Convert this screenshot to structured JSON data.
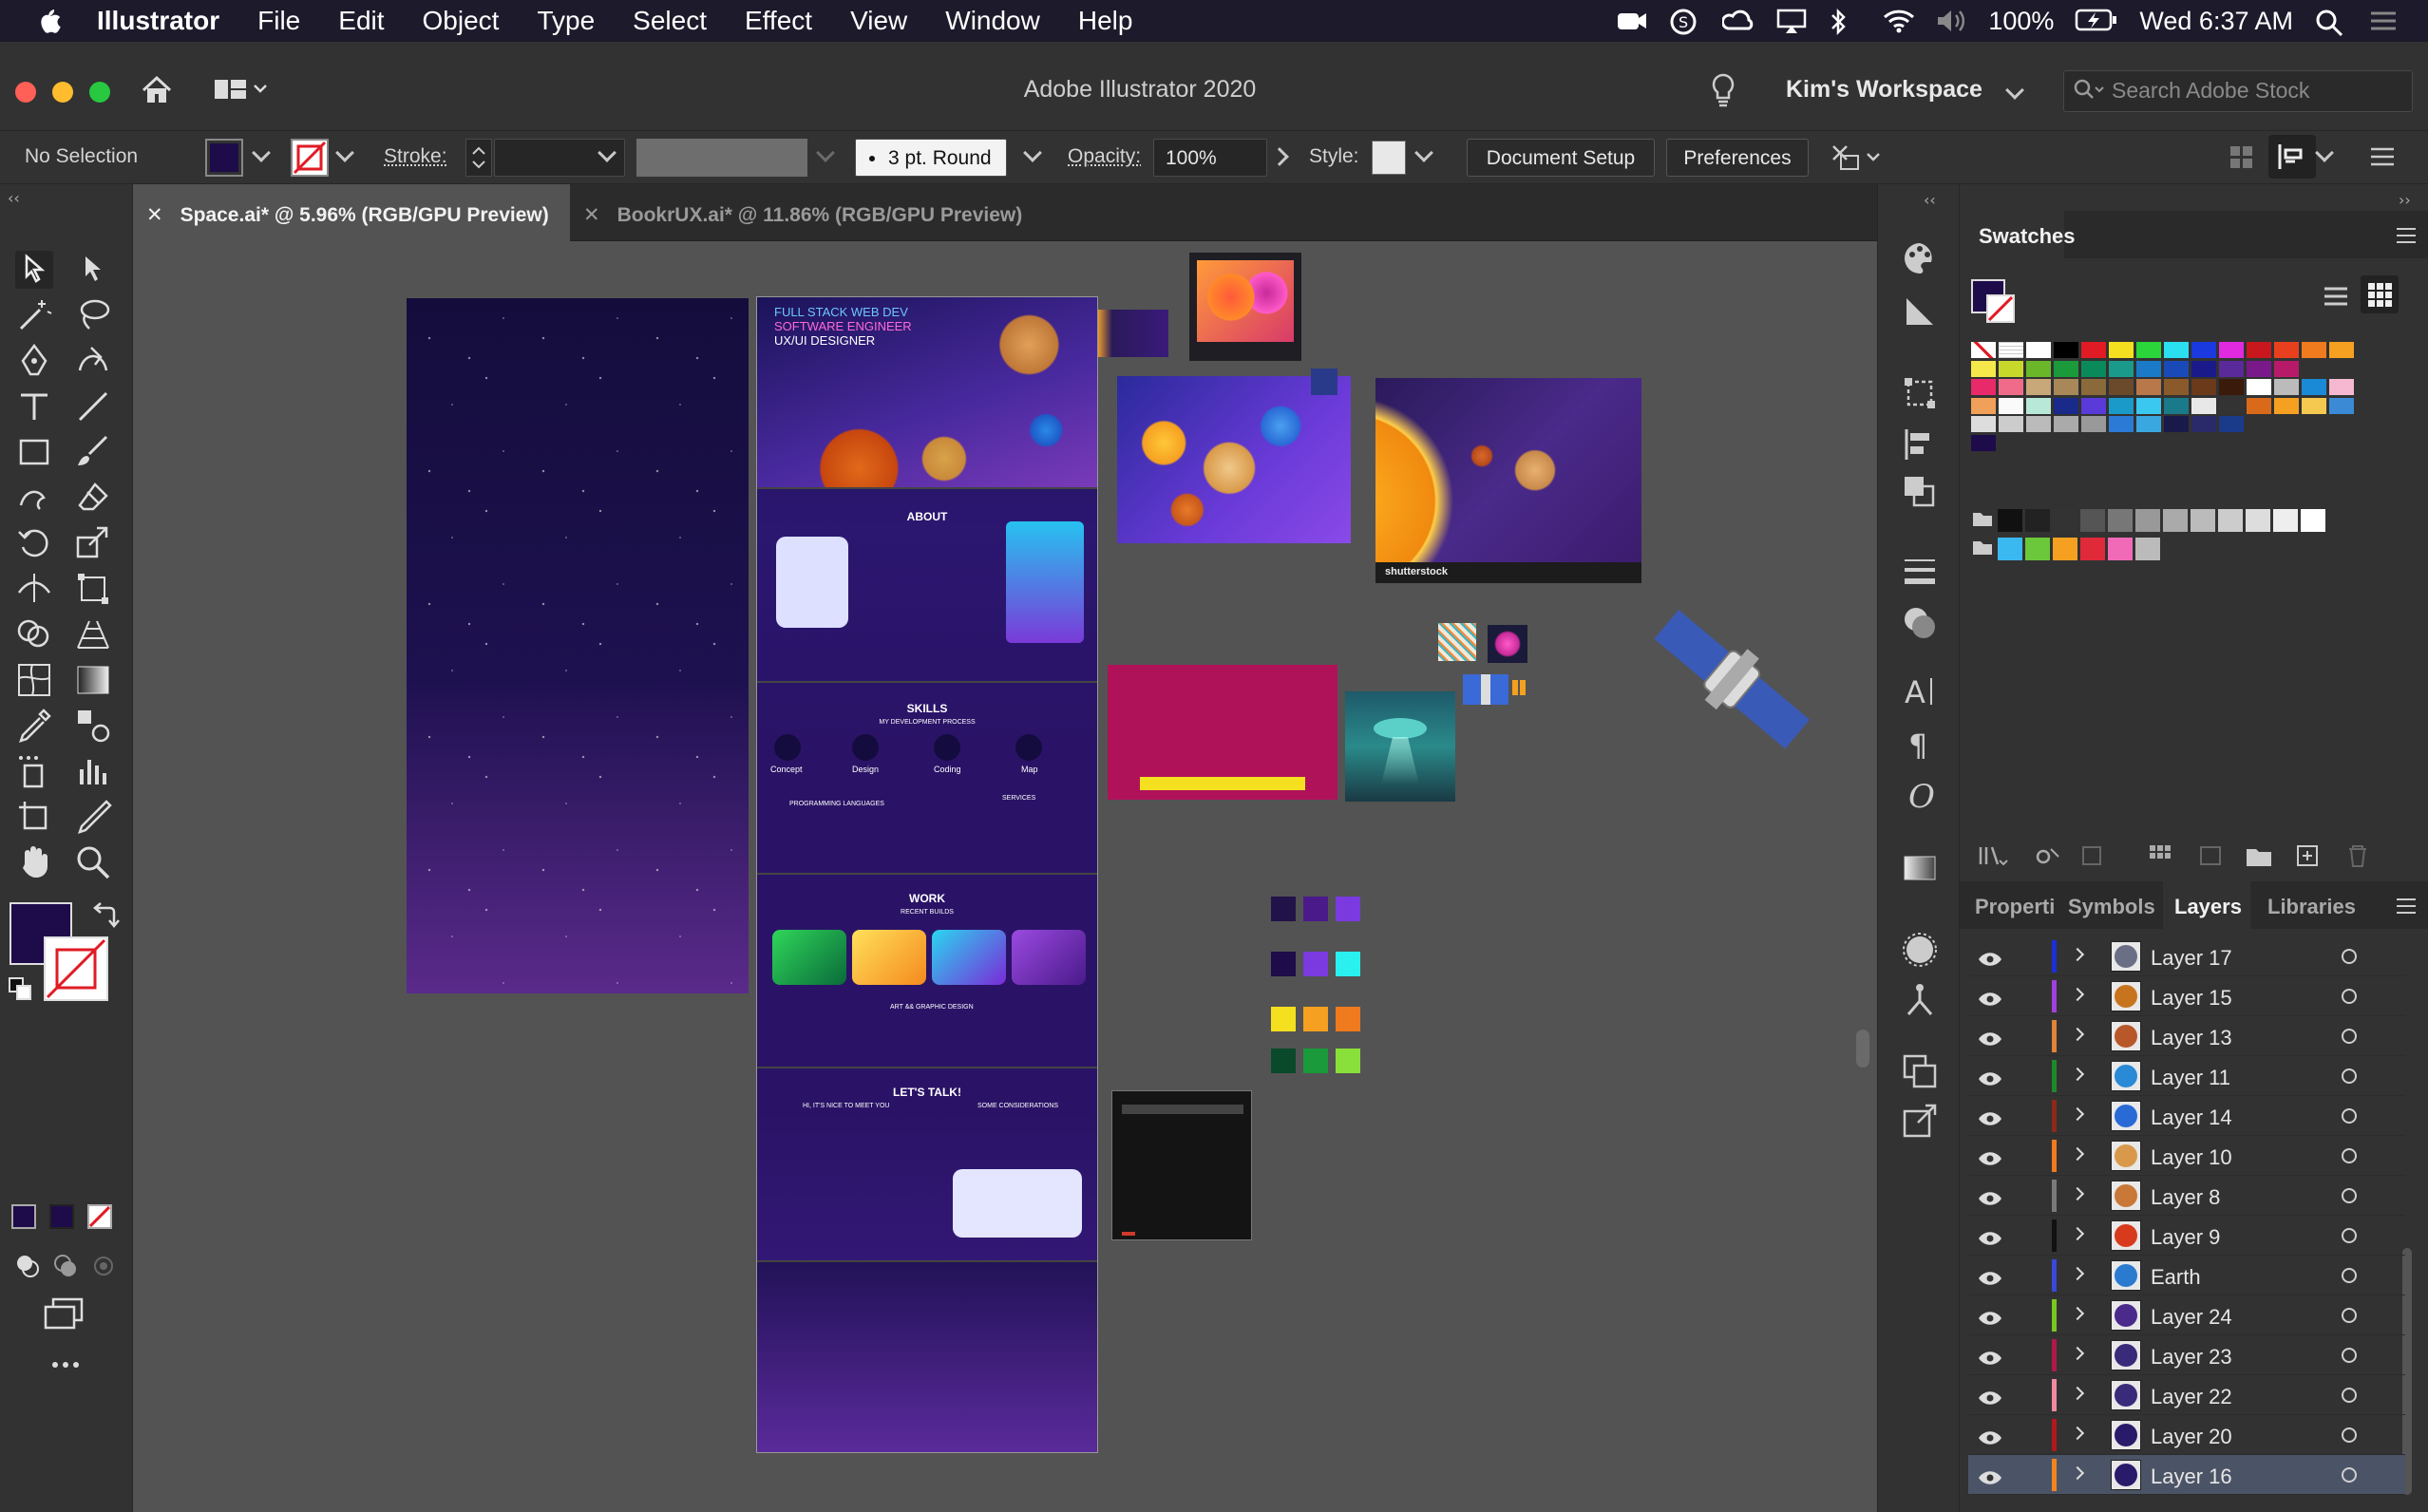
{
  "menubar": {
    "app": "Illustrator",
    "items": [
      "File",
      "Edit",
      "Object",
      "Type",
      "Select",
      "Effect",
      "View",
      "Window",
      "Help"
    ],
    "battery": "100%",
    "clock": "Wed 6:37 AM"
  },
  "titlebar": {
    "title": "Adobe Illustrator 2020",
    "workspace": "Kim's Workspace",
    "stock_placeholder": "Search Adobe Stock"
  },
  "controlbar": {
    "selection": "No Selection",
    "stroke_label": "Stroke:",
    "brush": "3 pt. Round",
    "opacity_label": "Opacity:",
    "opacity_value": "100%",
    "style_label": "Style:",
    "document_setup": "Document Setup",
    "preferences": "Preferences",
    "fill_color": "#1e0b4a"
  },
  "tabs": [
    {
      "label": "Space.ai* @ 5.96% (RGB/GPU Preview)",
      "active": true
    },
    {
      "label": "BookrUX.ai* @ 11.86% (RGB/GPU Preview)",
      "active": false
    }
  ],
  "panels": {
    "swatches_title": "Swatches",
    "bottom_tabs": [
      "Properti",
      "Symbols",
      "Layers",
      "Libraries"
    ],
    "active_bottom_tab": "Layers"
  },
  "layers": [
    {
      "name": "Layer 17",
      "color": "#1a2fd6",
      "thumb": "#6a6f86"
    },
    {
      "name": "Layer 15",
      "color": "#a040e0",
      "thumb": "#c8741e"
    },
    {
      "name": "Layer 13",
      "color": "#e0843a",
      "thumb": "#b8582a"
    },
    {
      "name": "Layer 11",
      "color": "#1c8a2c",
      "thumb": "#2a8ad6"
    },
    {
      "name": "Layer 14",
      "color": "#8a2a18",
      "thumb": "#2a6ad6"
    },
    {
      "name": "Layer 10",
      "color": "#f07a1e",
      "thumb": "#d89a4a"
    },
    {
      "name": "Layer 8",
      "color": "#7a7a7a",
      "thumb": "#c97838"
    },
    {
      "name": "Layer 9",
      "color": "#111111",
      "thumb": "#d83a1e"
    },
    {
      "name": "Earth",
      "color": "#3a48d8",
      "thumb": "#2a7ad0"
    },
    {
      "name": "Layer 24",
      "color": "#78c81e",
      "thumb": "#4a2a8a"
    },
    {
      "name": "Layer 23",
      "color": "#b01848",
      "thumb": "#3a2a7a"
    },
    {
      "name": "Layer 22",
      "color": "#f08aa0",
      "thumb": "#3a2a7a"
    },
    {
      "name": "Layer 20",
      "color": "#b0181e",
      "thumb": "#2a1a6a"
    },
    {
      "name": "Layer 16",
      "color": "#f0841e",
      "thumb": "#2a1a6a"
    }
  ],
  "artwork": {
    "hero_lines": [
      "FULL STACK WEB DEV",
      "SOFTWARE ENGINEER",
      "UX/UI DESIGNER"
    ],
    "sections": [
      "ABOUT",
      "SKILLS",
      "WORK",
      "LET'S TALK!"
    ],
    "skills_subtitle": "MY DEVELOPMENT PROCESS",
    "process_steps": [
      "Concept",
      "Design",
      "Coding",
      "Map"
    ],
    "work_subtitle": "RECENT BUILDS",
    "work_caption": "ART && GRAPHIC DESIGN",
    "skills_left": "PROGRAMMING LANGUAGES",
    "skills_right": "SERVICES",
    "talk_left": "HI, IT'S NICE TO MEET YOU",
    "talk_right": "SOME CONSIDERATIONS",
    "shutterstock": "shutterstock"
  }
}
